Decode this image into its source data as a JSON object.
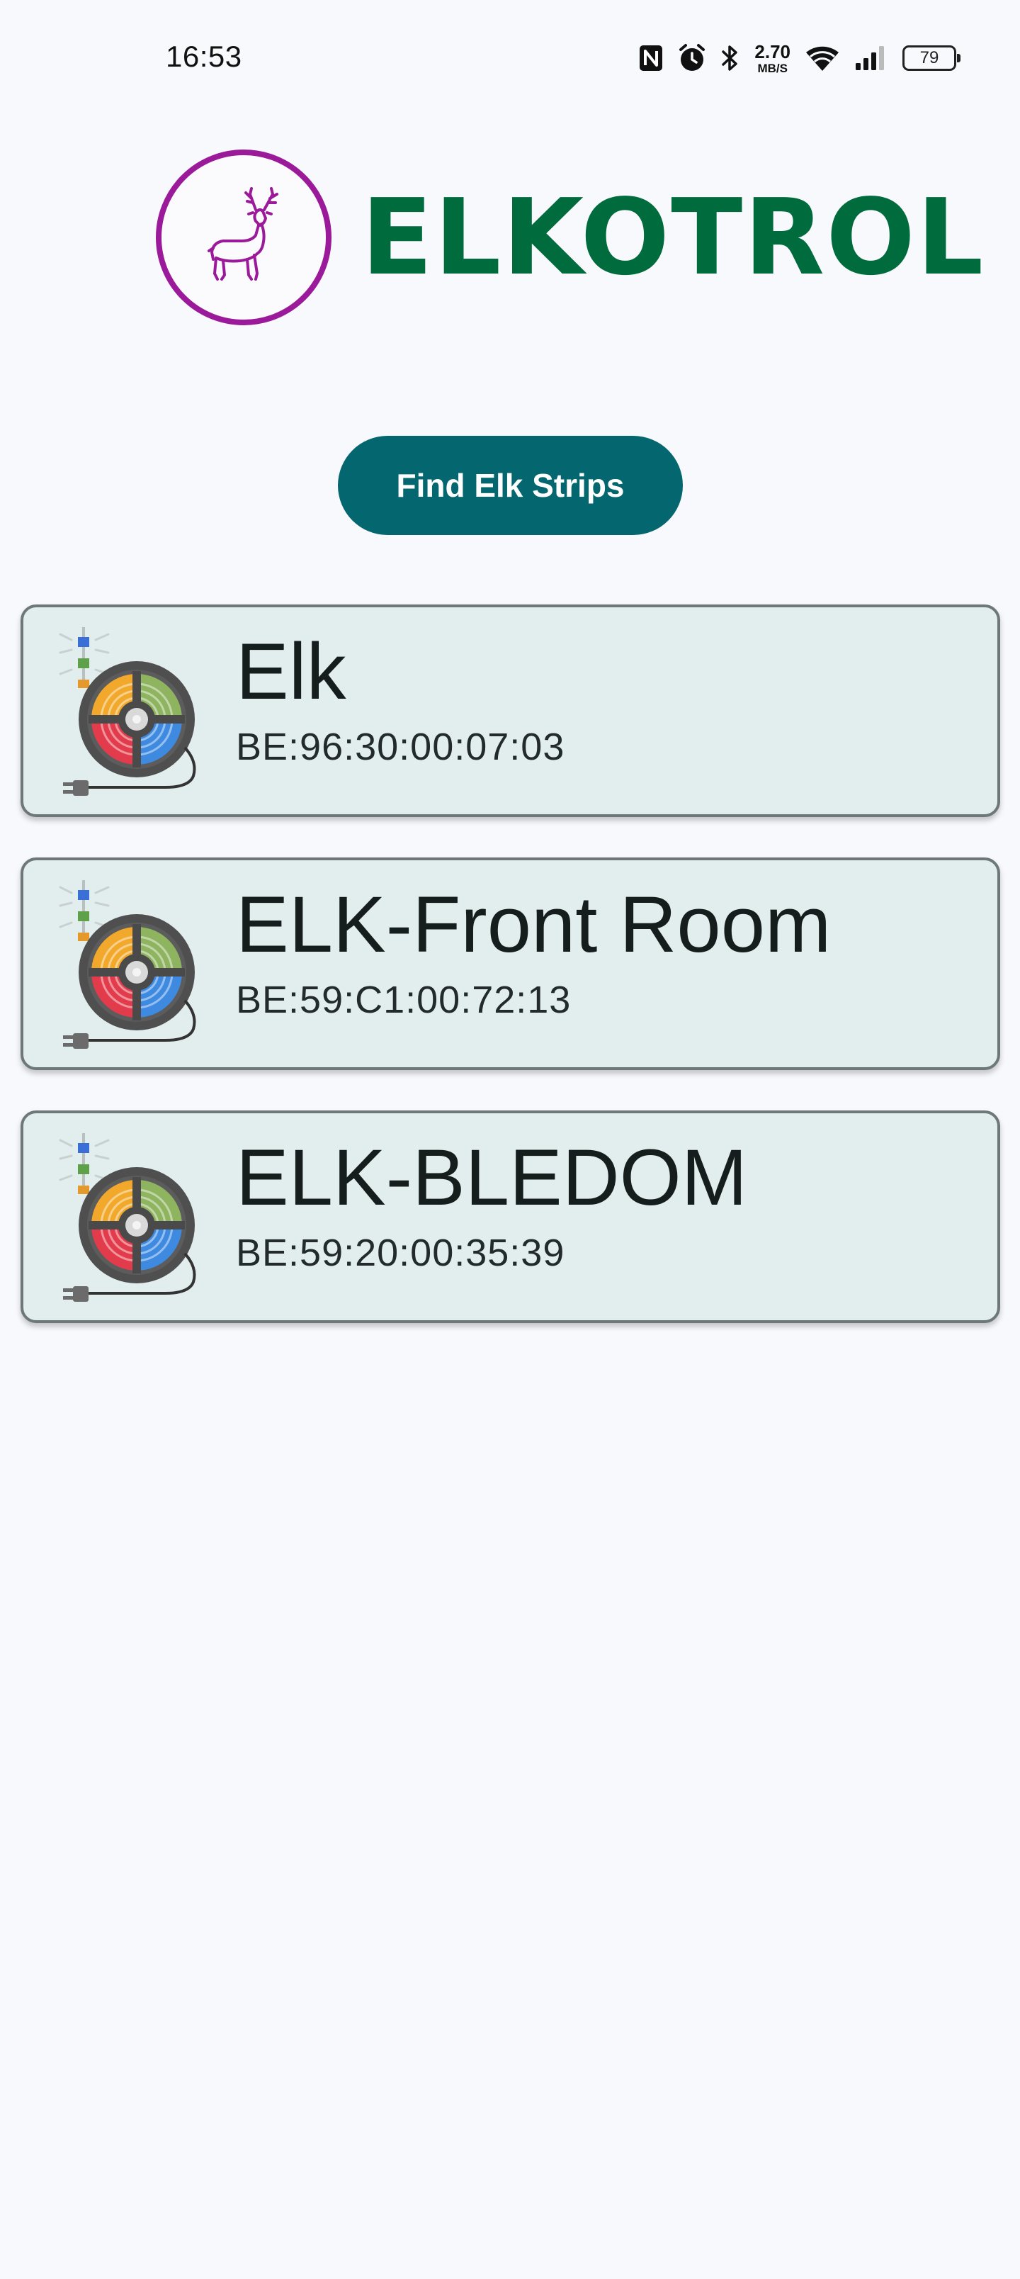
{
  "status_bar": {
    "time": "16:53",
    "net_speed_value": "2.70",
    "net_speed_unit": "MB/S",
    "battery": "79",
    "icons": [
      "nfc-icon",
      "alarm-icon",
      "bluetooth-icon",
      "wifi-icon",
      "signal-icon",
      "battery-icon"
    ]
  },
  "header": {
    "logo_icon": "elk-icon",
    "app_name": "ELKOTROL",
    "brand_color": "#006b3c",
    "logo_ring_color": "#9a1a9a"
  },
  "actions": {
    "find_button_label": "Find Elk Strips",
    "button_color": "#04666f"
  },
  "devices": [
    {
      "name": "Elk",
      "mac": "BE:96:30:00:07:03",
      "icon": "led-strip-reel-icon"
    },
    {
      "name": "ELK-Front Room",
      "mac": "BE:59:C1:00:72:13",
      "icon": "led-strip-reel-icon"
    },
    {
      "name": "ELK-BLEDOM",
      "mac": "BE:59:20:00:35:39",
      "icon": "led-strip-reel-icon"
    }
  ]
}
